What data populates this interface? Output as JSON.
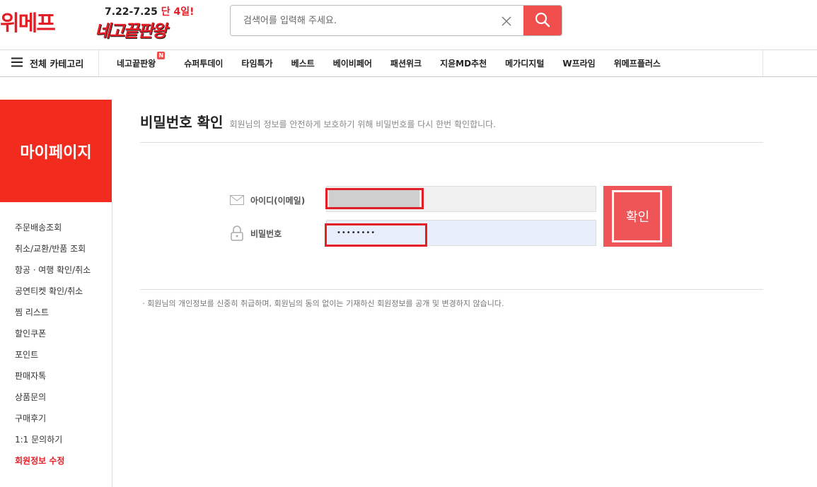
{
  "header": {
    "logo": "위메프",
    "promo_date": "7.22-7.25",
    "promo_days": "단 4일!",
    "promo_title": "네고끝판왕",
    "search_placeholder": "검색어를 입력해 주세요."
  },
  "nav": {
    "all_categories": "전체 카테고리",
    "items": [
      "네고끝판왕",
      "슈퍼투데이",
      "타임특가",
      "베스트",
      "베이비페어",
      "패션위크",
      "지윤MD추천",
      "메가디지털",
      "W프라임",
      "위메프플러스"
    ],
    "badge": "N"
  },
  "sidebar": {
    "title": "마이페이지",
    "menu": [
      "주문배송조회",
      "취소/교환/반품 조회",
      "항공ㆍ여행 확인/취소",
      "공연티켓 확인/취소",
      "찜 리스트",
      "할인쿠폰",
      "포인트",
      "판매자톡",
      "상품문의",
      "구매후기",
      "1:1 문의하기",
      "회원정보 수정"
    ]
  },
  "main": {
    "title": "비밀번호 확인",
    "desc": "회원님의 정보를 안전하게 보호하기 위해 비밀번호를 다시 한번 확인합니다.",
    "id_label": "아이디(이메일)",
    "pw_label": "비밀번호",
    "pw_value": "••••••••",
    "confirm": "확인",
    "notice": "ㆍ회원님의 개인정보를 신중히 취급하며, 회원님의 동의 없이는 기재하신 회원정보를 공개 및 변경하지 않습니다."
  },
  "colors": {
    "brand_red": "#e41e26",
    "button_red": "#ef5456"
  }
}
